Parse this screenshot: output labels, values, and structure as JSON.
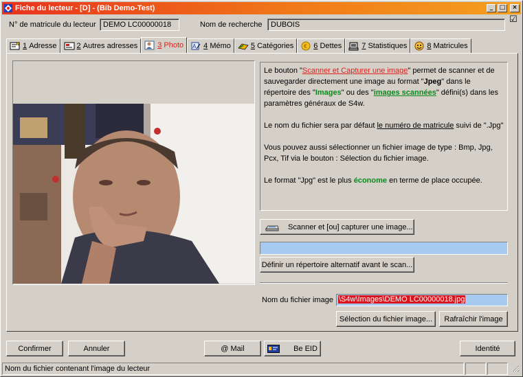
{
  "window": {
    "title": "Fiche du lecteur - [D] - (Bib Demo-Test)",
    "min": "_",
    "max": "□",
    "close": "×"
  },
  "header": {
    "matricule_label": "N° de matricule du lecteur",
    "matricule_value": "DEMO LC00000018",
    "recherche_label": "Nom de recherche",
    "recherche_value": "DUBOIS",
    "check_glyph": "☑"
  },
  "tabs": [
    {
      "num": "1",
      "label": "Adresse",
      "icon": "address-icon"
    },
    {
      "num": "2",
      "label": "Autres adresses",
      "icon": "card-icon"
    },
    {
      "num": "3",
      "label": "Photo",
      "icon": "photo-icon"
    },
    {
      "num": "4",
      "label": "Mémo",
      "icon": "memo-icon"
    },
    {
      "num": "5",
      "label": "Catégories",
      "icon": "categories-icon"
    },
    {
      "num": "6",
      "label": "Dettes",
      "icon": "coin-icon"
    },
    {
      "num": "7",
      "label": "Statistiques",
      "icon": "stats-icon"
    },
    {
      "num": "8",
      "label": "Matricules",
      "icon": "face-icon"
    }
  ],
  "info": {
    "p1_a": "Le bouton \"",
    "p1_link": "Scanner et Capturer une image",
    "p1_b": "\" permet de scanner et de sauvegarder directement une image au format \"",
    "p1_jpeg": "Jpeg",
    "p1_c": "\" dans le répertoire des \"",
    "p1_images": "Images",
    "p1_d": "\" ou des \"",
    "p1_scannees": "images scannées",
    "p1_e": "\" défini(s) dans les paramètres généraux de S4w.",
    "p2_a": "Le nom du fichier sera par défaut ",
    "p2_u": "le numéro de matricule",
    "p2_b": " suivi de \".Jpg\"",
    "p3": "Vous pouvez aussi sélectionner un fichier image de type : Bmp, Jpg, Pcx, Tif via le bouton : Sélection du fichier image.",
    "p4_a": "Le format \"Jpg\" est le plus ",
    "p4_b": "économe",
    "p4_c": " en terme de place occupée."
  },
  "buttons": {
    "scanner": "Scanner et [ou] capturer une image...",
    "repertoire": "Définir un répertoire alternatif avant le scan...",
    "selection": "Sélection du fichier image...",
    "rafraichir": "Rafraîchir l'image",
    "confirmer": "Confirmer",
    "annuler": "Annuler",
    "mail": "@ Mail",
    "beeid": "Be EID",
    "identite": "Identité"
  },
  "file": {
    "label": "Nom du fichier image",
    "value": "\\S4w\\Images\\DEMO LC00000018.jpg"
  },
  "status": {
    "text": "Nom du fichier contenant l'image du lecteur"
  }
}
